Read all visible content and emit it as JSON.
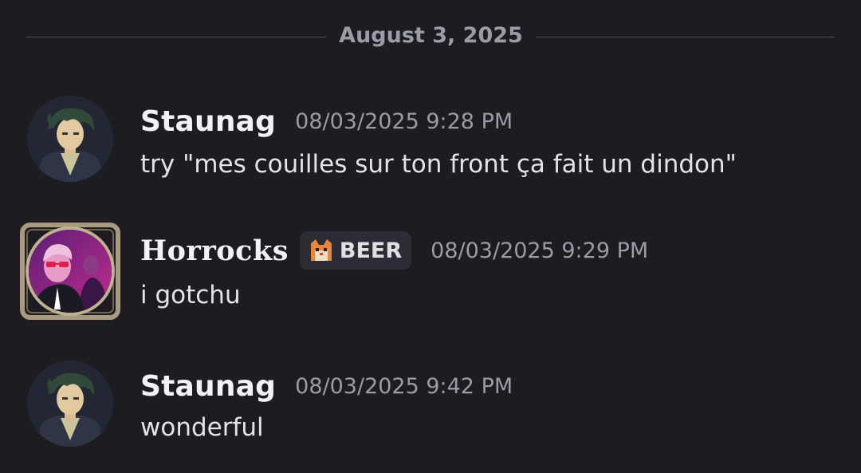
{
  "date_divider": {
    "label": "August 3, 2025"
  },
  "messages": [
    {
      "username": "Staunag",
      "timestamp": "08/03/2025 9:28 PM",
      "text": "try \"mes couilles sur ton front ça fait un dindon\""
    },
    {
      "username": "Horrocks",
      "tag": {
        "icon": "cat-emoji-icon",
        "label": "BEER"
      },
      "timestamp": "08/03/2025 9:29 PM",
      "text": "i gotchu"
    },
    {
      "username": "Staunag",
      "timestamp": "08/03/2025 9:42 PM",
      "text": "wonderful"
    }
  ],
  "colors": {
    "background": "#1c1c21",
    "muted_text": "#9a9ca6",
    "divider": "#4a4c55",
    "tag_bg": "#2c2d34"
  }
}
